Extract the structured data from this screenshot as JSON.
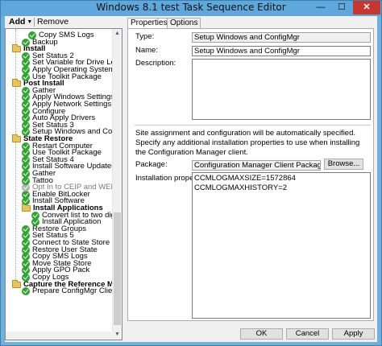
{
  "window": {
    "title": "Windows 8.1 test Task Sequence Editor",
    "controls": {
      "minimize": "—",
      "maximize": "☐",
      "close": "✕"
    }
  },
  "toolbar": {
    "add_label": "Add",
    "remove_label": "Remove"
  },
  "tree": {
    "items": [
      {
        "label": "Copy SMS Logs",
        "type": "step"
      },
      {
        "label": "Backup",
        "type": "step"
      },
      {
        "label": "Install",
        "type": "group"
      },
      {
        "label": "Set Status 2",
        "type": "step"
      },
      {
        "label": "Set Variable for Drive Letter",
        "type": "step"
      },
      {
        "label": "Apply Operating System Image",
        "type": "step"
      },
      {
        "label": "Use Toolkit Package",
        "type": "step"
      },
      {
        "label": "Post Install",
        "type": "group"
      },
      {
        "label": "Gather",
        "type": "step"
      },
      {
        "label": "Apply Windows Settings",
        "type": "step"
      },
      {
        "label": "Apply Network Settings",
        "type": "step"
      },
      {
        "label": "Configure",
        "type": "step"
      },
      {
        "label": "Auto Apply Drivers",
        "type": "step"
      },
      {
        "label": "Set Status 3",
        "type": "step"
      },
      {
        "label": "Setup Windows and ConfigMgr",
        "type": "step"
      },
      {
        "label": "State Restore",
        "type": "group"
      },
      {
        "label": "Restart Computer",
        "type": "step"
      },
      {
        "label": "Use Toolkit Package",
        "type": "step"
      },
      {
        "label": "Set Status 4",
        "type": "step"
      },
      {
        "label": "Install Software Updates",
        "type": "step"
      },
      {
        "label": "Gather",
        "type": "step"
      },
      {
        "label": "Tattoo",
        "type": "step"
      },
      {
        "label": "Opt In to CEIP and WER",
        "type": "disabled"
      },
      {
        "label": "Enable BitLocker",
        "type": "step"
      },
      {
        "label": "Install Software",
        "type": "step"
      },
      {
        "label": "Install Applications",
        "type": "group"
      },
      {
        "label": "Convert list to two digits",
        "type": "step"
      },
      {
        "label": "Install Application",
        "type": "step"
      },
      {
        "label": "Restore Groups",
        "type": "step"
      },
      {
        "label": "Set Status 5",
        "type": "step"
      },
      {
        "label": "Connect to State Store",
        "type": "step"
      },
      {
        "label": "Restore User State",
        "type": "step"
      },
      {
        "label": "Copy SMS Logs",
        "type": "step"
      },
      {
        "label": "Move State Store",
        "type": "step"
      },
      {
        "label": "Apply GPO Pack",
        "type": "step"
      },
      {
        "label": "Copy Logs",
        "type": "step"
      },
      {
        "label": "Capture the Reference Machi",
        "type": "group"
      },
      {
        "label": "Prepare ConfigMgr Client",
        "type": "step"
      }
    ]
  },
  "tabs": [
    {
      "label": "Properties"
    },
    {
      "label": "Options"
    }
  ],
  "properties": {
    "type_label": "Type:",
    "type_value": "Setup Windows and ConfigMgr",
    "name_label": "Name:",
    "name_value": "Setup Windows and ConfigMgr",
    "description_label": "Description:",
    "description_value": "",
    "info_text": "Site assignment and configuration will be automatically specified. Specify any additional installation properties to use when installing the Configuration Manager client.",
    "package_label": "Package:",
    "package_value": "Configuration Manager Client Package",
    "browse_label": "Browse...",
    "install_props_label": "Installation properties:",
    "install_props_value": "CCMLOGMAXSIZE=1572864 CCMLOGMAXHISTORY=2"
  },
  "footer": {
    "ok_label": "OK",
    "cancel_label": "Cancel",
    "apply_label": "Apply"
  },
  "colors": {
    "title_bar": "#5ea8dc",
    "close_button": "#c7372f",
    "check_icon": "#2ea62e",
    "folder_icon": "#e8c45c"
  }
}
